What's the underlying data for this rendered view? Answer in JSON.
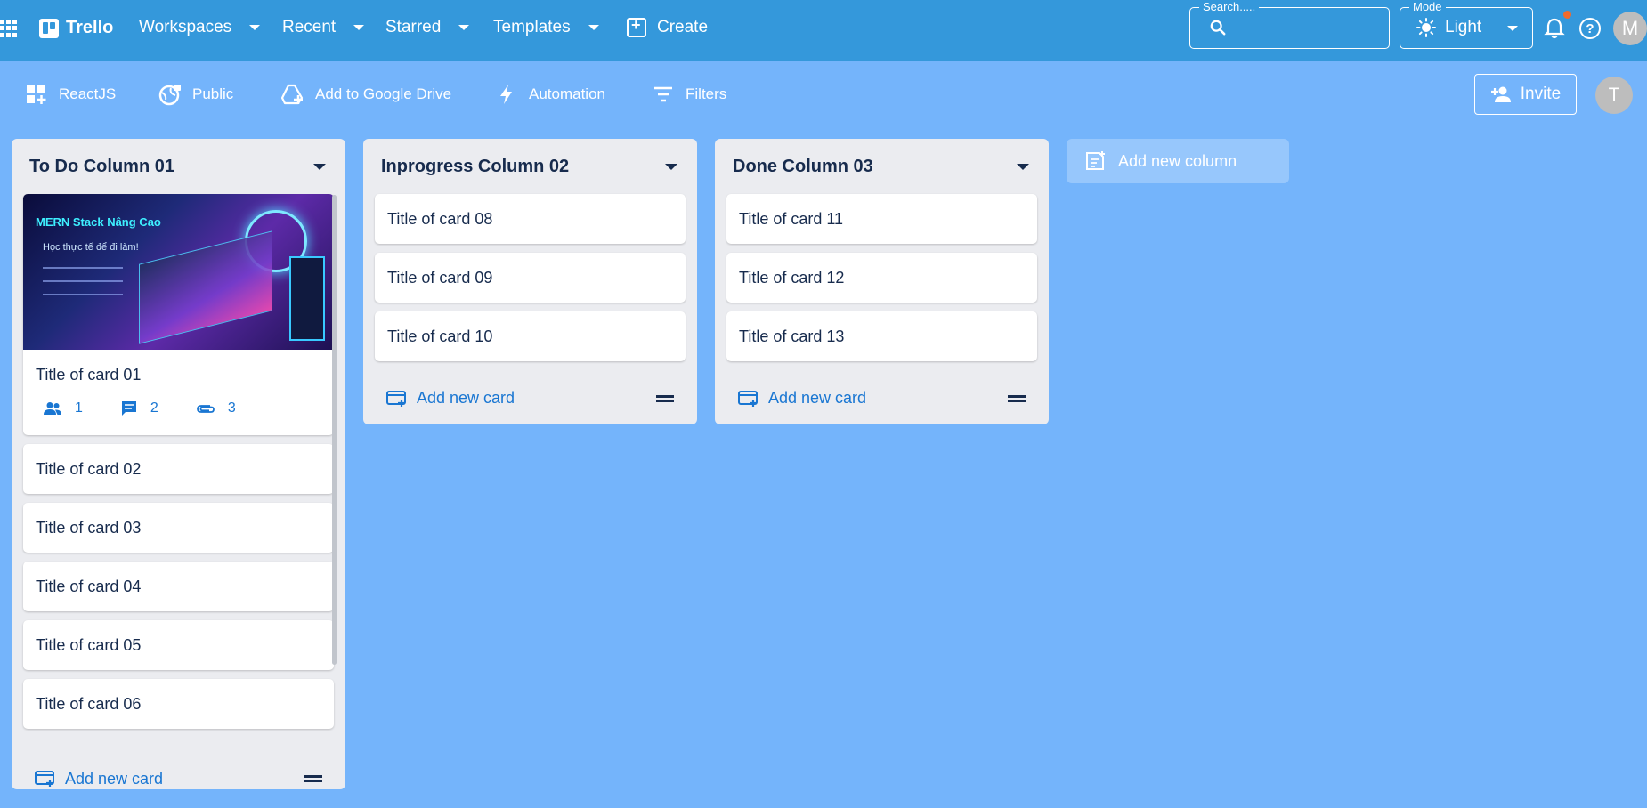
{
  "topbar": {
    "brand": "Trello",
    "nav": [
      "Workspaces",
      "Recent",
      "Starred",
      "Templates"
    ],
    "create_label": "Create",
    "search_label": "Search.....",
    "search_value": "",
    "mode_label": "Mode",
    "mode_value": "Light",
    "avatar_initial": "M"
  },
  "boardbar": {
    "board_name": "ReactJS",
    "visibility": "Public",
    "drive": "Add to Google Drive",
    "automation": "Automation",
    "filters": "Filters",
    "invite_label": "Invite",
    "avatar_initial": "T"
  },
  "columns": [
    {
      "title": "To Do Column 01",
      "cover": {
        "line1": "MERN Stack Nâng Cao",
        "line2": "Học thực tế để đi làm!"
      },
      "first_card": {
        "title": "Title of card 01",
        "members": "1",
        "comments": "2",
        "attachments": "3"
      },
      "cards": [
        "Title of card 02",
        "Title of card 03",
        "Title of card 04",
        "Title of card 05",
        "Title of card 06"
      ],
      "add_label": "Add new card"
    },
    {
      "title": "Inprogress Column 02",
      "cards": [
        "Title of card 08",
        "Title of card 09",
        "Title of card 10"
      ],
      "add_label": "Add new card"
    },
    {
      "title": "Done Column 03",
      "cards": [
        "Title of card 11",
        "Title of card 12",
        "Title of card 13"
      ],
      "add_label": "Add new card"
    }
  ],
  "add_column_label": "Add new column",
  "colors": {
    "appbar": "#3498db",
    "board_bg": "#74b4fb",
    "column_bg": "#ebecf0",
    "accent": "#1976d2",
    "notification_dot": "#f06a2c"
  }
}
